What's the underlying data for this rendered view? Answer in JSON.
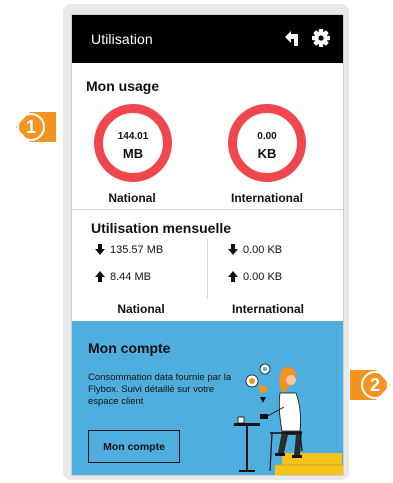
{
  "header": {
    "title": "Utilisation",
    "back_icon": "back-arrow-icon",
    "settings_icon": "gear-icon"
  },
  "usage": {
    "title": "Mon usage",
    "national": {
      "value": "144.01",
      "unit": "MB",
      "label": "National"
    },
    "international": {
      "value": "0.00",
      "unit": "KB",
      "label": "International"
    },
    "ring_color": "#f0464e"
  },
  "monthly": {
    "title": "Utilisation mensuelle",
    "national": {
      "download": "135.57 MB",
      "upload": "8.44 MB",
      "label": "National"
    },
    "international": {
      "download": "0.00 KB",
      "upload": "0.00 KB",
      "label": "International"
    }
  },
  "account": {
    "title": "Mon compte",
    "description": "Consommation data fournie par la Flybox. Suivi détaillé sur votre espace client",
    "button_label": "Mon compte",
    "background": "#4eaede"
  },
  "callouts": {
    "first": "1",
    "second": "2",
    "color": "#f39422"
  }
}
